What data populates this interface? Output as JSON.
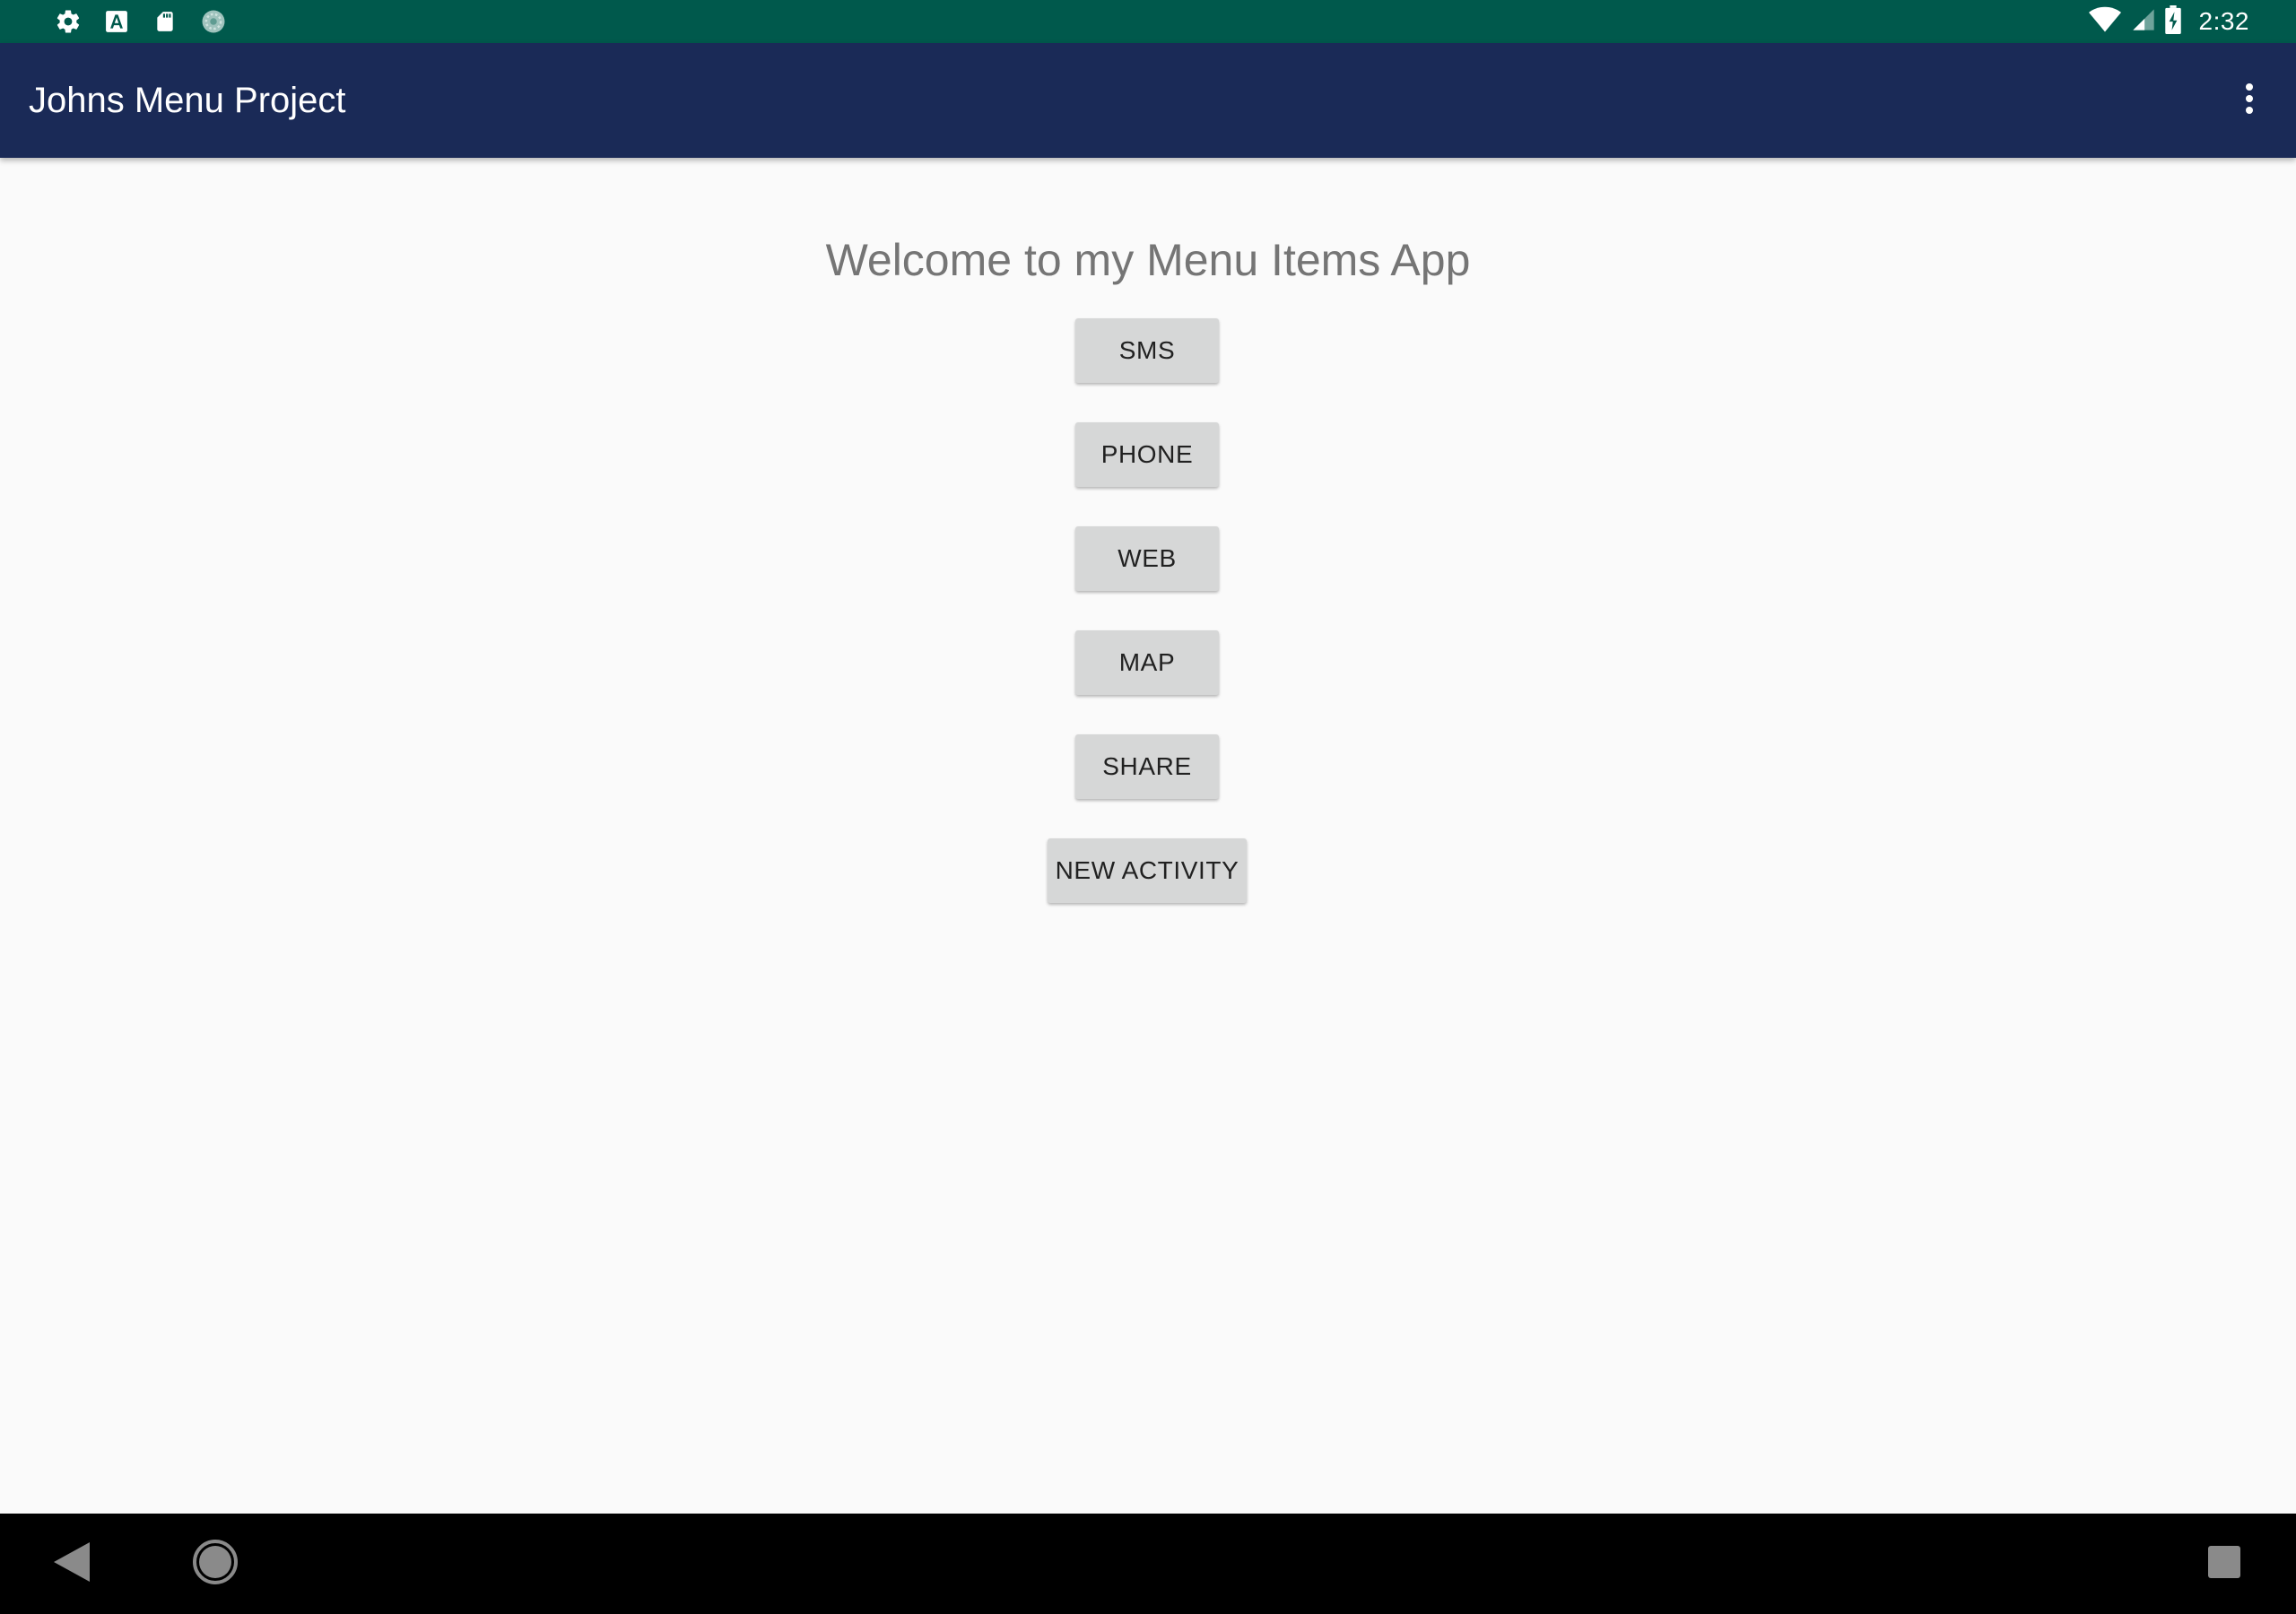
{
  "status_bar": {
    "time": "2:32",
    "left_icons": [
      "settings-icon",
      "text-a-icon",
      "sd-card-icon",
      "sync-circle-icon"
    ],
    "right_icons": [
      "wifi-icon",
      "cell-signal-icon",
      "battery-charging-icon"
    ]
  },
  "app_bar": {
    "title": "Johns Menu Project",
    "overflow_icon": "more-vert-icon"
  },
  "main": {
    "welcome_text": "Welcome to my Menu Items App",
    "buttons": [
      {
        "label": "SMS"
      },
      {
        "label": "PHONE"
      },
      {
        "label": "WEB"
      },
      {
        "label": "MAP"
      },
      {
        "label": "SHARE"
      },
      {
        "label": "NEW ACTIVITY"
      }
    ]
  },
  "nav_bar": {
    "icons": [
      "back-icon",
      "home-icon",
      "recents-icon"
    ]
  },
  "colors": {
    "status_bar": "#00594c",
    "app_bar": "#1a2a57",
    "background": "#fafafa",
    "button": "#d6d7d7",
    "welcome_text": "#757575"
  }
}
